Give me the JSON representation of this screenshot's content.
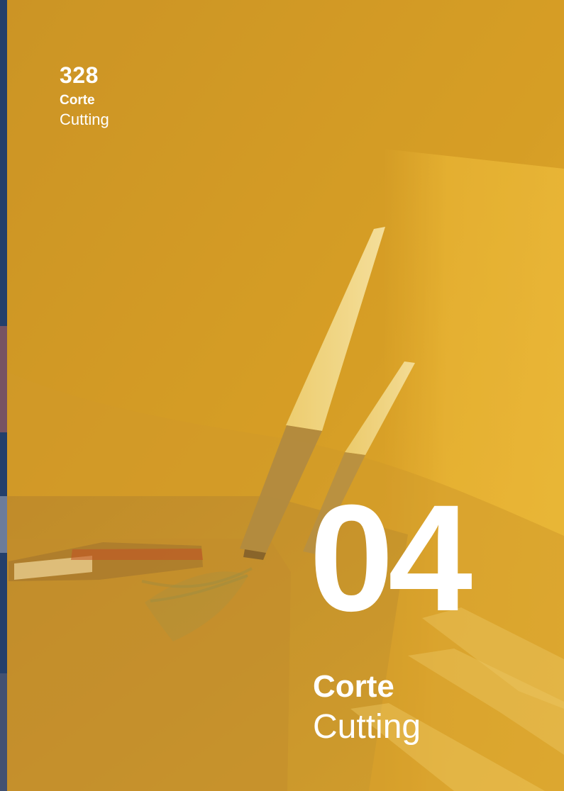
{
  "header": {
    "page_number": "328",
    "section_es": "Corte",
    "section_en": "Cutting"
  },
  "chapter": {
    "number": "04",
    "title_es": "Corte",
    "title_en": "Cutting"
  },
  "colors": {
    "overlay_yellow": "#d8a12a",
    "text": "#ffffff",
    "left_strip": "#243f6b"
  },
  "image": {
    "subject": "knives-on-cutting-board-photo"
  }
}
